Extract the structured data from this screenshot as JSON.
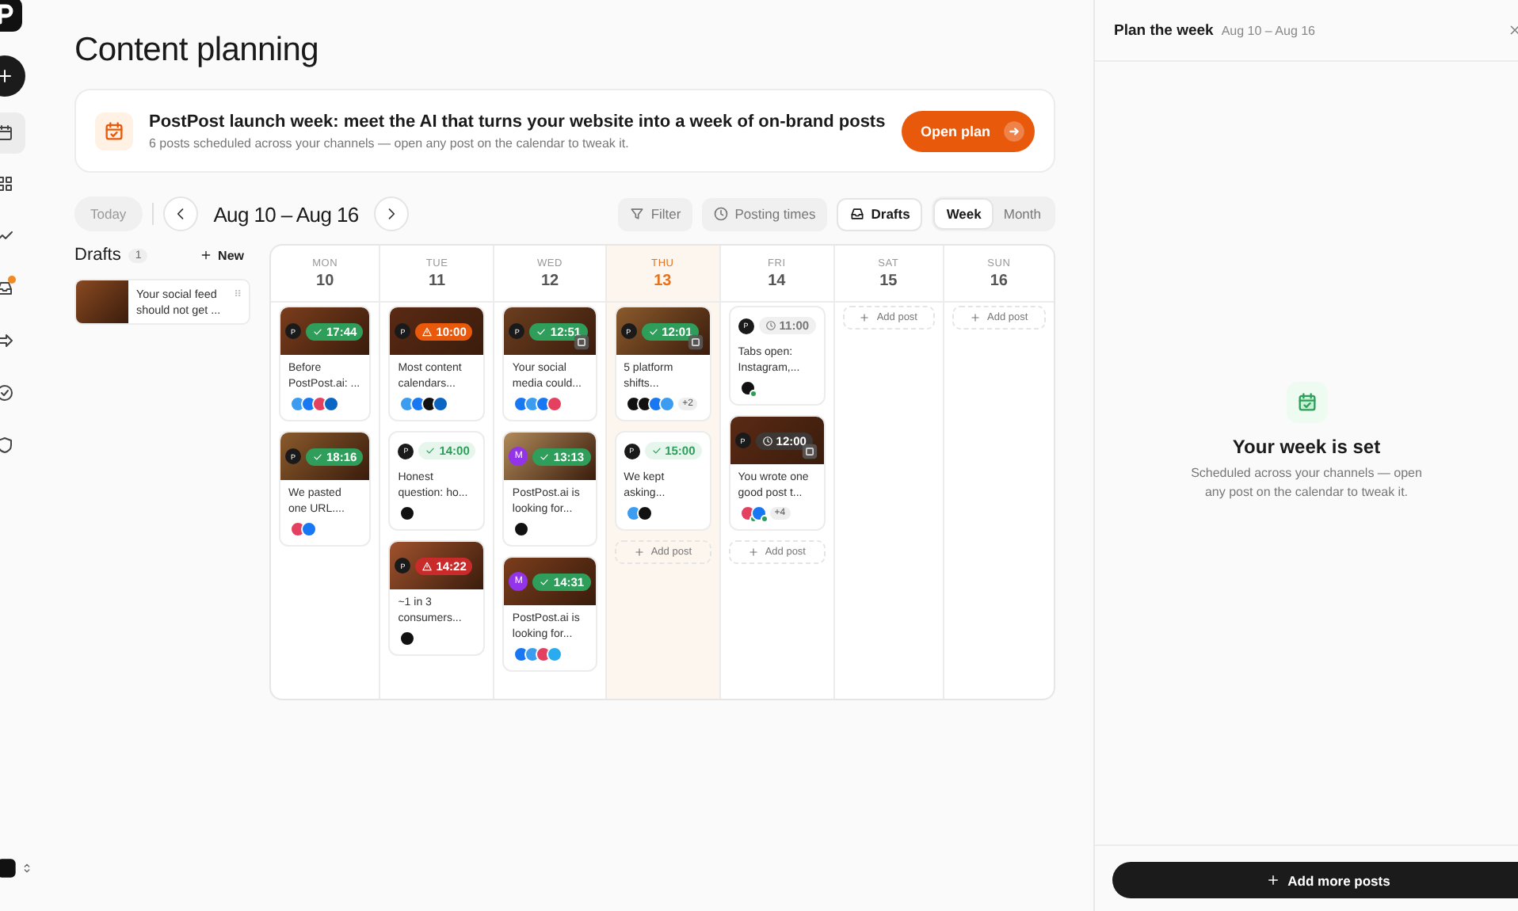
{
  "sidebar": {
    "items": [
      {
        "kind": "calendar",
        "selected": true,
        "badge": false
      },
      {
        "kind": "grid",
        "selected": false,
        "badge": false
      },
      {
        "kind": "trend",
        "selected": false,
        "badge": false
      },
      {
        "kind": "inbox",
        "selected": false,
        "badge": true
      },
      {
        "kind": "share",
        "selected": false,
        "badge": false
      },
      {
        "kind": "check",
        "selected": false,
        "badge": false
      },
      {
        "kind": "shield",
        "selected": false,
        "badge": false
      }
    ]
  },
  "page_title": "Content planning",
  "banner": {
    "title": "PostPost launch week: meet the AI that turns your website into a week of on-brand posts",
    "subtitle": "6 posts scheduled across your channels — open any post on the calendar to tweak it.",
    "button": "Open plan"
  },
  "toolbar": {
    "today": "Today",
    "range": "Aug 10 – Aug 16",
    "filters": [
      {
        "kind": "filter",
        "label": "Filter",
        "selected": false
      },
      {
        "kind": "clock",
        "label": "Posting times",
        "selected": false
      },
      {
        "kind": "drafts",
        "label": "Drafts",
        "selected": true
      }
    ],
    "views": [
      {
        "label": "Week",
        "selected": true
      },
      {
        "label": "Month",
        "selected": false
      }
    ]
  },
  "drafts": {
    "title": "Drafts",
    "count": "1",
    "new_label": "New",
    "items": [
      {
        "text": "Your social feed should not get ..."
      }
    ]
  },
  "days": [
    {
      "weekday": "MON",
      "date": "10",
      "today": false,
      "posts": [
        {
          "kind": "image",
          "author": "P",
          "badge": {
            "kind": "published",
            "time": "17:44"
          },
          "gallery": false,
          "text": "Before PostPost.ai: ...",
          "channels": [
            {
              "kind": "bluesky"
            },
            {
              "kind": "facebook"
            },
            {
              "kind": "instagram"
            },
            {
              "kind": "linkedin"
            }
          ]
        },
        {
          "kind": "image",
          "author": "P",
          "badge": {
            "kind": "published",
            "time": "18:16"
          },
          "gallery": false,
          "text": "We pasted one URL....",
          "channels": [
            {
              "kind": "instagram"
            },
            {
              "kind": "facebook"
            }
          ]
        }
      ]
    },
    {
      "weekday": "TUE",
      "date": "11",
      "today": false,
      "posts": [
        {
          "kind": "image",
          "author": "P",
          "badge": {
            "kind": "warning",
            "time": "10:00"
          },
          "gallery": false,
          "text": "Most content calendars...",
          "channels": [
            {
              "kind": "bluesky"
            },
            {
              "kind": "facebook"
            },
            {
              "kind": "threads"
            },
            {
              "kind": "linkedin"
            }
          ]
        },
        {
          "kind": "plain",
          "author": "P",
          "badge": {
            "kind": "published",
            "time": "14:00"
          },
          "gallery": false,
          "text": "Honest question: ho...",
          "channels": [
            {
              "kind": "threads"
            }
          ]
        },
        {
          "kind": "image",
          "author": "P",
          "badge": {
            "kind": "error",
            "time": "14:22"
          },
          "gallery": false,
          "text": "~1 in 3 consumers...",
          "channels": [
            {
              "kind": "x"
            }
          ]
        }
      ]
    },
    {
      "weekday": "WED",
      "date": "12",
      "today": false,
      "posts": [
        {
          "kind": "image",
          "author": "P",
          "badge": {
            "kind": "published",
            "time": "12:51"
          },
          "gallery": true,
          "text": "Your social media could...",
          "channels": [
            {
              "kind": "facebook"
            },
            {
              "kind": "bluesky"
            },
            {
              "kind": "facebook"
            },
            {
              "kind": "instagram"
            }
          ]
        },
        {
          "kind": "image",
          "author": "M",
          "badge": {
            "kind": "published",
            "time": "13:13"
          },
          "gallery": false,
          "text": "PostPost.ai is looking for...",
          "channels": [
            {
              "kind": "threads"
            }
          ]
        },
        {
          "kind": "image",
          "author": "M",
          "badge": {
            "kind": "published",
            "time": "14:31"
          },
          "gallery": false,
          "text": "PostPost.ai is looking for...",
          "channels": [
            {
              "kind": "facebook"
            },
            {
              "kind": "bluesky"
            },
            {
              "kind": "instagram"
            },
            {
              "kind": "telegram"
            }
          ]
        }
      ]
    },
    {
      "weekday": "THU",
      "date": "13",
      "today": true,
      "add_post": "Add post",
      "posts": [
        {
          "kind": "image",
          "author": "P",
          "badge": {
            "kind": "published",
            "time": "12:01"
          },
          "gallery": true,
          "text": "5 platform shifts...",
          "channels": [
            {
              "kind": "threads"
            },
            {
              "kind": "threads"
            },
            {
              "kind": "facebook"
            },
            {
              "kind": "bluesky"
            }
          ],
          "more": "+2"
        },
        {
          "kind": "plain",
          "author": "P",
          "badge": {
            "kind": "published",
            "time": "15:00"
          },
          "gallery": false,
          "text": "We kept asking...",
          "channels": [
            {
              "kind": "bluesky"
            },
            {
              "kind": "x"
            }
          ]
        }
      ]
    },
    {
      "weekday": "FRI",
      "date": "14",
      "today": false,
      "add_post": "Add post",
      "posts": [
        {
          "kind": "plain",
          "author": "P",
          "badge": {
            "kind": "scheduled",
            "time": "11:00"
          },
          "gallery": false,
          "text": "Tabs open: Instagram,...",
          "channels": [
            {
              "kind": "threads",
              "verified": true
            }
          ]
        },
        {
          "kind": "image",
          "author": "P",
          "badge": {
            "kind": "scheduled",
            "time": "12:00"
          },
          "gallery": true,
          "text": "You wrote one good post t...",
          "channels": [
            {
              "kind": "instagram",
              "verified": true
            },
            {
              "kind": "facebook",
              "verified": true
            }
          ],
          "more": "+4"
        }
      ]
    },
    {
      "weekday": "SAT",
      "date": "15",
      "today": false,
      "add_post": "Add post"
    },
    {
      "weekday": "SUN",
      "date": "16",
      "today": false,
      "add_post": "Add post"
    }
  ],
  "panel": {
    "title": "Plan the week",
    "range": "Aug 10 – Aug 16",
    "empty_title": "Your week is set",
    "empty_text": "Scheduled across your channels — open any post on the calendar to tweak it.",
    "button": "Add more posts"
  }
}
